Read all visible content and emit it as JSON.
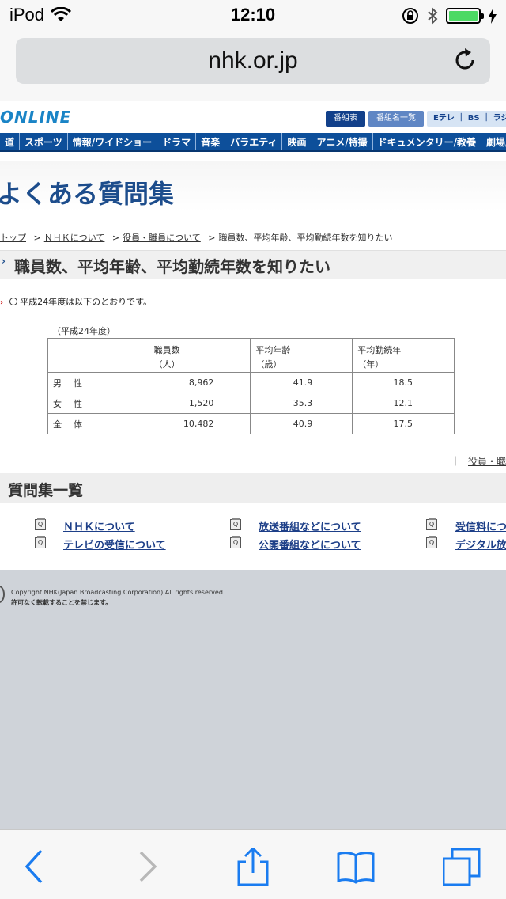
{
  "status_bar": {
    "device": "iPod",
    "time": "12:10"
  },
  "browser": {
    "url": "nhk.or.jp"
  },
  "site": {
    "logo": "ONLINE",
    "header_buttons": [
      "番組表",
      "番組名一覧",
      "Eテレ ｜ BS ｜ ラジオ第"
    ],
    "nav": [
      "道",
      "スポーツ",
      "情報/ワイドショー",
      "ドラマ",
      "音楽",
      "バラエティ",
      "映画",
      "アニメ/特撮",
      "ドキュメンタリー/教養",
      "劇場/公"
    ]
  },
  "page": {
    "title": "よくある質問集",
    "breadcrumb": [
      "トップ",
      "ＮＨＫについて",
      "役員・職員について",
      "職員数、平均年齢、平均勤続年数を知りたい"
    ],
    "question": "職員数、平均年齢、平均勤続年数を知りたい",
    "question_mark": "›",
    "answer_mark": "›",
    "answer_intro": "平成24年度は以下のとおりです。",
    "table_note": "（平成24年度）",
    "table": {
      "headers": [
        {
          "label": "職員数",
          "unit": "（人）"
        },
        {
          "label": "平均年齢",
          "unit": "（歳）"
        },
        {
          "label": "平均勤続年",
          "unit": "（年）"
        }
      ],
      "rows": [
        {
          "label": "男　性",
          "values": [
            "8,962",
            "41.9",
            "18.5"
          ]
        },
        {
          "label": "女　性",
          "values": [
            "1,520",
            "35.3",
            "12.1"
          ]
        },
        {
          "label": "全　体",
          "values": [
            "10,482",
            "40.9",
            "17.5"
          ]
        }
      ]
    },
    "back_link": "役員・職員",
    "list_title": "質問集一覧",
    "question_links": [
      "ＮＨＫについて",
      "放送番組などについて",
      "受信料につ",
      "テレビの受信について",
      "公開番組などについて",
      "デジタル放"
    ],
    "footer": {
      "copyright": "Copyright NHK(Japan Broadcasting Corporation) All rights reserved.",
      "notice": "許可なく転載することを禁じます。"
    }
  },
  "colors": {
    "nav_bg": "#0d4f9a",
    "title": "#1d4d8c",
    "battery": "#4cd964",
    "toolbar_icon": "#1a7cf0"
  }
}
